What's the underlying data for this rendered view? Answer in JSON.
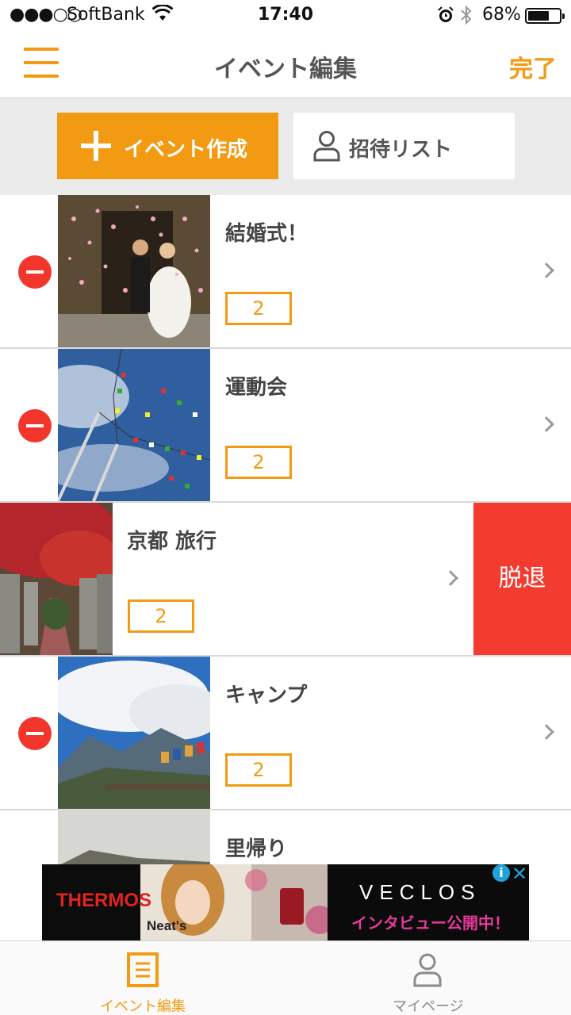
{
  "status_bar": {
    "signal": "●●●○○",
    "carrier": "SoftBank",
    "time": "17:40",
    "battery": "68%",
    "battery_level": 0.68
  },
  "nav": {
    "title": "イベント編集",
    "done_label": "完了",
    "accent_color": "#f29a12"
  },
  "actions": {
    "create_label": "イベント作成",
    "invite_label": "招待リスト"
  },
  "events": [
    {
      "title": "結婚式！",
      "count": "2",
      "thumb": "wedding-photo"
    },
    {
      "title": "運動会",
      "count": "2",
      "thumb": "flags-sky-photo"
    },
    {
      "title": "京都 旅行",
      "count": "2",
      "thumb": "autumn-path-photo",
      "swipe_action": "脱退"
    },
    {
      "title": "キャンプ",
      "count": "2",
      "thumb": "mountain-clouds-photo"
    },
    {
      "title": "里帰り",
      "thumb": "hazy-hill-photo"
    }
  ],
  "ad": {
    "brand": "THERMOS",
    "product": "Neat's",
    "headline": "VECLOS",
    "subline": "インタビュー公開中！",
    "info_label": "i",
    "close_label": "✕"
  },
  "tabs": [
    {
      "label": "イベント編集",
      "icon": "list-document-icon",
      "active": true
    },
    {
      "label": "マイページ",
      "icon": "person-icon",
      "active": false
    }
  ]
}
